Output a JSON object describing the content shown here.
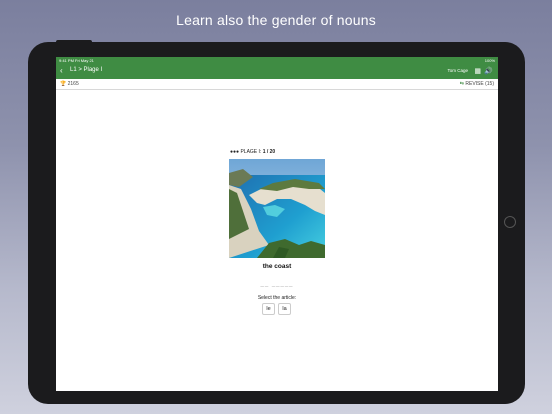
{
  "headline": "Learn also the gender of nouns",
  "status": {
    "time": "9:41 PM   Fri May 21",
    "right": "100%"
  },
  "nav": {
    "back_icon": "chevron-left-icon",
    "title": "L1 > Plage I",
    "user": "Tom Cage"
  },
  "subbar": {
    "score": "2165",
    "revise": "REVISE (15)"
  },
  "lesson": {
    "label": "PLAGE I: ",
    "progress": "1 / 20"
  },
  "card": {
    "word": "the coast",
    "blank": "__ _____"
  },
  "prompt": "Select the article:",
  "choices": [
    "le",
    "la"
  ],
  "colors": {
    "accent": "#3f8c43"
  }
}
